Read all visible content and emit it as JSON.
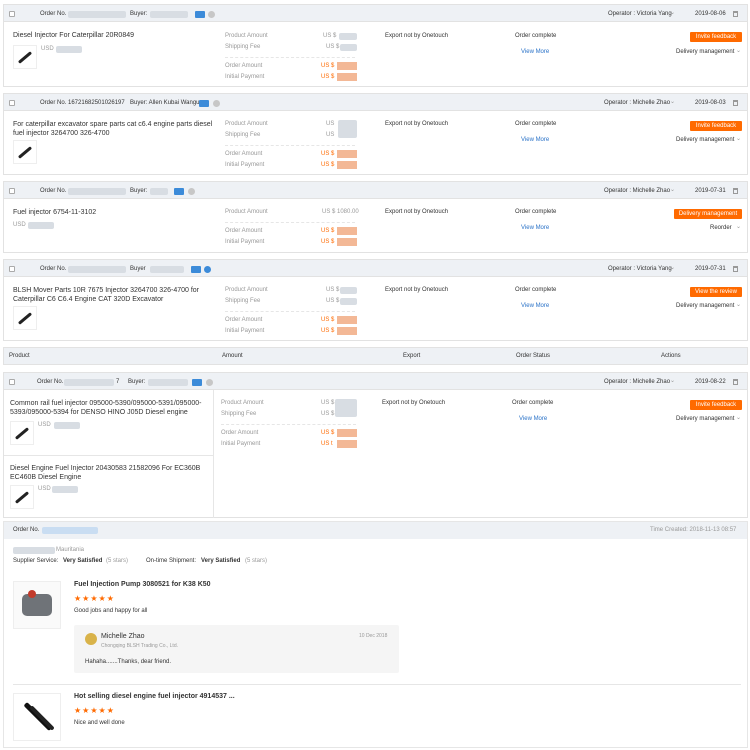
{
  "orders": [
    {
      "order_label": "Order No.",
      "order_no": "",
      "buyer_label": "Buyer:",
      "buyer": "",
      "operator": "Operator : Victoria Yang",
      "date": "2019-08-06",
      "product": "Diesel Injector For Caterpillar 20R0849",
      "usd": "USD",
      "amount_labels": [
        "Product Amount",
        "Shipping Fee",
        "Order Amount",
        "Initial Payment"
      ],
      "amount_values": [
        "US $",
        "US $",
        "US $",
        "US $"
      ],
      "export": "Export not by Onetouch",
      "status": "Order complete",
      "view": "View More",
      "button": "Invite feedback",
      "action": "Delivery management"
    },
    {
      "order_label": "Order No. 16721682501026197",
      "buyer_label": "Buyer: Allen Kubai Wangu",
      "operator": "Operator : Michelle Zhao",
      "date": "2019-08-03",
      "product": "For caterpillar excavator spare parts cat c6.4 engine parts diesel fuel injector 3264700 326-4700",
      "usd": "",
      "amount_labels": [
        "Product Amount",
        "Shipping Fee",
        "Order Amount",
        "Initial Payment"
      ],
      "amount_values": [
        "US",
        "US",
        "US $",
        "US $"
      ],
      "export": "Export not by Onetouch",
      "status": "Order complete",
      "view": "View More",
      "button": "Invite feedback",
      "action": "Delivery management"
    },
    {
      "order_label": "Order No.",
      "buyer_label": "Buyer:",
      "operator": "Operator : Michelle Zhao",
      "date": "2019-07-31",
      "product": "Fuel injector 6754-11-3102",
      "usd": "USD",
      "amount_labels": [
        "Product Amount",
        "Order Amount",
        "Initial Payment"
      ],
      "amount_values": [
        "US $ 1080.00",
        "US $",
        "US $"
      ],
      "export": "Export not by Onetouch",
      "status": "Order complete",
      "view": "View More",
      "button": "Delivery management",
      "action": "Reorder"
    },
    {
      "order_label": "Order No.",
      "buyer_label": "Buyer",
      "operator": "Operator : Victoria Yang",
      "date": "2019-07-31",
      "product": "BLSH Mover Parts 10R 7675 Injector 3264700 326-4700 for Caterpillar C6 C6.4 Engine CAT 320D Excavator",
      "usd": "",
      "amount_labels": [
        "Product Amount",
        "Shipping Fee",
        "Order Amount",
        "Initial Payment"
      ],
      "amount_values": [
        "US $",
        "US $",
        "US $",
        "US $"
      ],
      "export": "Export not by Onetouch",
      "status": "Order complete",
      "view": "View More",
      "button": "View the review",
      "action": "Delivery management"
    }
  ],
  "table_header": {
    "product": "Product",
    "amount": "Amount",
    "export": "Export",
    "status": "Order Status",
    "actions": "Actions"
  },
  "order5": {
    "order_label": "Order No.",
    "order_suffix": "7",
    "buyer_label": "Buyer:",
    "operator": "Operator : Michelle Zhao",
    "date": "2019-08-22",
    "product1": "Common rail fuel injector 095000-5390/095000-5391/095000-5393/095000-5394 for DENSO HINO J05D Diesel engine",
    "usd1": "USD",
    "product2": "Diesel Engine Fuel Injector 20430583 21582096 For EC360B EC460B Diesel Engine",
    "usd2": "USD",
    "amount_labels": [
      "Product Amount",
      "Shipping Fee",
      "Order Amount",
      "Initial Payment"
    ],
    "amount_values": [
      "US $",
      "US $",
      "US $",
      "US t"
    ],
    "export": "Export not by Onetouch",
    "status": "Order complete",
    "view": "View More",
    "button": "Invite feedback",
    "action": "Delivery management"
  },
  "review": {
    "order_label": "Order No.",
    "time_created": "Time Created: 2018-11-13 08:57",
    "country": "Mauritania",
    "supplier_label": "Supplier Service:",
    "supplier_value": "Very Satisfied",
    "supplier_stars": "(5 stars)",
    "shipment_label": "On-time Shipment:",
    "shipment_value": "Very Satisfied",
    "shipment_stars": "(5 stars)",
    "items": [
      {
        "title": "Fuel Injection Pump 3080521 for K38 K50",
        "stars": "★★★★★",
        "comment": "Good jobs and happy for all",
        "reply_name": "Michelle Zhao",
        "reply_company": "Chongqing BLSH Trading Co., Ltd.",
        "reply_date": "10 Dec 2018",
        "reply_text": "Hahaha.......Thanks, dear friend."
      },
      {
        "title": "Hot selling diesel engine fuel injector 4914537 ...",
        "stars": "★★★★★",
        "comment": "Nice and well done"
      }
    ]
  }
}
